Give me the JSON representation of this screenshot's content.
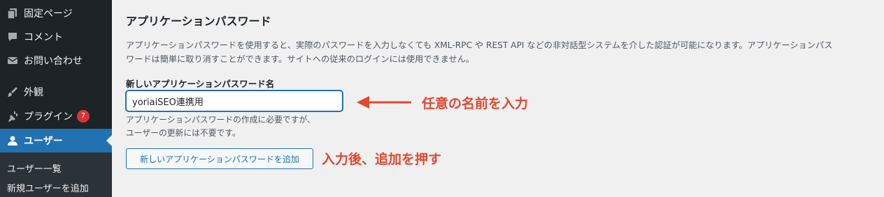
{
  "sidebar": {
    "items": [
      {
        "label": "固定ページ",
        "icon": "pages-icon"
      },
      {
        "label": "コメント",
        "icon": "comment-icon"
      },
      {
        "label": "お問い合わせ",
        "icon": "mail-icon"
      },
      {
        "label": "外観",
        "icon": "brush-icon"
      },
      {
        "label": "プラグイン",
        "icon": "plugin-icon",
        "badge": "7"
      },
      {
        "label": "ユーザー",
        "icon": "user-icon",
        "active": true
      }
    ],
    "submenu": [
      {
        "label": "ユーザー一覧"
      },
      {
        "label": "新規ユーザーを追加"
      }
    ]
  },
  "section": {
    "title": "アプリケーションパスワード",
    "description_line1": "アプリケーションパスワードを使用すると、実際のパスワードを入力しなくても XML-RPC や REST API などの非対話型システムを介した認証が可能になります。アプリケーションパス",
    "description_line2": "ワードは簡単に取り消すことができます。サイトへの従来のログインには使用できません。"
  },
  "form": {
    "label": "新しいアプリケーションパスワード名",
    "value": "yoriaiSEO連携用",
    "help_line1": "アプリケーションパスワードの作成に必要ですが、",
    "help_line2": "ユーザーの更新には不要です。",
    "button_label": "新しいアプリケーションパスワードを追加"
  },
  "annotations": {
    "name_note": "任意の名前を入力",
    "button_note": "入力後、追加を押す",
    "color": "#e1482f"
  },
  "colors": {
    "sidebar_bg": "#1d2327",
    "accent": "#2271b1",
    "badge": "#d63638",
    "content_bg": "#f0f0f1"
  }
}
